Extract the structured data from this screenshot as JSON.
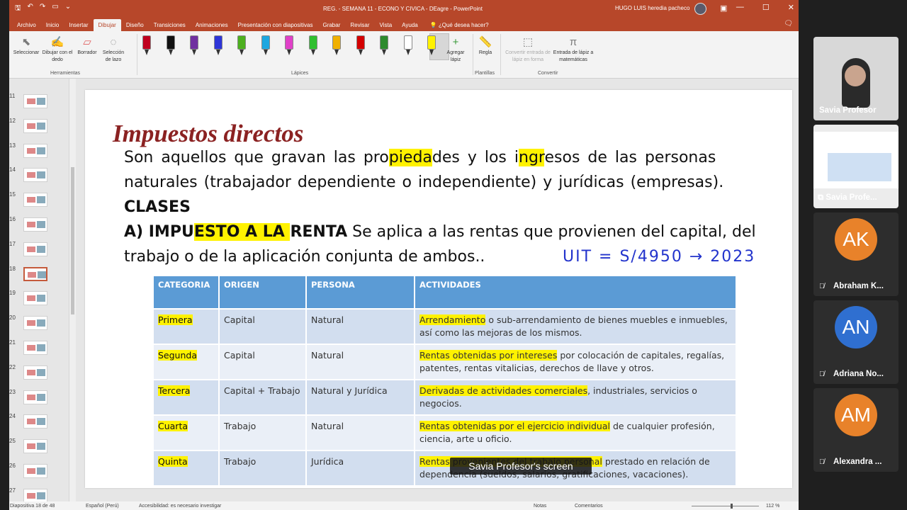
{
  "ppt": {
    "title": "REG. - SEMANA 11 - ECONO Y CIVICA - DEagre  -  PowerPoint",
    "user": "HUGO LUIS heredia pacheco",
    "menu_tabs": [
      "Archivo",
      "Inicio",
      "Insertar",
      "Dibujar",
      "Diseño",
      "Transiciones",
      "Animaciones",
      "Presentación con diapositivas",
      "Grabar",
      "Revisar",
      "Vista",
      "Ayuda"
    ],
    "active_tab_index": 3,
    "search": "¿Qué desea hacer?",
    "ribbon": {
      "tools": [
        {
          "label": "Seleccionar",
          "icon": "cursor-icon"
        },
        {
          "label": "Dibujar con el dedo",
          "icon": "finger-draw-icon"
        },
        {
          "label": "Borrador",
          "icon": "eraser-icon"
        },
        {
          "label": "Selección de lazo",
          "icon": "lasso-icon"
        }
      ],
      "group_herramientas": "Herramientas",
      "group_lapices": "Lápices",
      "add_pen": "Agregar lápiz",
      "regla": "Regla",
      "group_plantillas": "Plantillas",
      "convert_ink_shape": "Convertir entrada de lápiz en forma",
      "convert_math": "Entrada de lápiz a matemáticas",
      "group_convertir": "Convertir",
      "pen_colors": [
        "#c0001e",
        "#111111",
        "#7030a0",
        "#2e35d8",
        "#4caf1e",
        "#1ea7e0",
        "#e040c8",
        "#2fbf2f",
        "#f0b000",
        "#d40000",
        "#2d8a2d",
        "#ffffff",
        "#fff200"
      ]
    },
    "thumbnails": {
      "numbers": [
        "11",
        "12",
        "13",
        "14",
        "15",
        "16",
        "17",
        "18",
        "19",
        "20",
        "21",
        "22",
        "23",
        "24",
        "25",
        "26",
        "27"
      ],
      "active": "18"
    },
    "slide": {
      "title": "Impuestos directos",
      "body_line1": [
        "Son aquellos que gravan las pro",
        "pieda",
        "des y los i",
        "ngr",
        "esos de las personas"
      ],
      "body_line2": "naturales (trabajador dependiente o independiente) y jurídicas (empresas).",
      "clases": "CLASES",
      "impuesto_bold": [
        "A) IMPU",
        "ESTO A LA ",
        "RENTA"
      ],
      "impuesto_rest": " Se aplica a las rentas que provienen del capital, del",
      "body_line3": "trabajo o de la aplicación conjunta de ambos..",
      "handwriting": "UIT = S/4950 → 2023",
      "table": {
        "headers": [
          "CATEGORIA",
          "ORIGEN",
          "PERSONA",
          "ACTIVIDADES"
        ],
        "rows": [
          {
            "cat": "Primera",
            "origen": "Capital",
            "persona": "Natural",
            "act_hl": "Arrendamiento",
            "act": " o sub-arrendamiento de bienes muebles e inmuebles, así como las mejoras de los mismos."
          },
          {
            "cat": "Segunda",
            "origen": "Capital",
            "persona": "Natural",
            "act_hl": "Rentas obtenidas por intereses",
            "act": " por colocación de capitales, regalías, patentes, rentas vitalicias, derechos de llave y otros."
          },
          {
            "cat": "Tercera",
            "origen": "Capital + Trabajo",
            "persona": "Natural y Jurídica",
            "act_hl": "Derivadas de actividades comerciales",
            "act": ", industriales, servicios o negocios."
          },
          {
            "cat": "Cuarta",
            "origen": "Trabajo",
            "persona": "Natural",
            "act_hl": "Rentas obtenidas por el ejercicio individual",
            "act": " de cualquier profesión, ciencia, arte u oficio."
          },
          {
            "cat": "Quinta",
            "origen": "Trabajo",
            "persona": "Jurídica",
            "act_hl": "Rentas provenientes del trabajo personal",
            "act": " prestado en relación de dependencia (sueldos, salarios, gratificaciones, vacaciones)."
          }
        ]
      }
    },
    "screen_label": "Savia Profesor's screen",
    "status": {
      "slide_info": "Diapositiva 18 de 48",
      "language": "Español (Perú)",
      "accessibility": "Accesibilidad: es necesario investigar",
      "notes": "Notas",
      "comments": "Comentarios",
      "zoom": "112 %"
    }
  },
  "meeting": {
    "participants": [
      {
        "name": "Savia Profesor",
        "type": "video"
      },
      {
        "name": "Savia Profe...",
        "type": "share"
      },
      {
        "name": "Abraham K...",
        "initials": "AK",
        "color": "#e8822a",
        "muted": true
      },
      {
        "name": "Adriana No...",
        "initials": "AN",
        "color": "#2f6fd0",
        "muted": true
      },
      {
        "name": "Alexandra ...",
        "initials": "AM",
        "color": "#e8822a",
        "muted": true
      }
    ]
  }
}
